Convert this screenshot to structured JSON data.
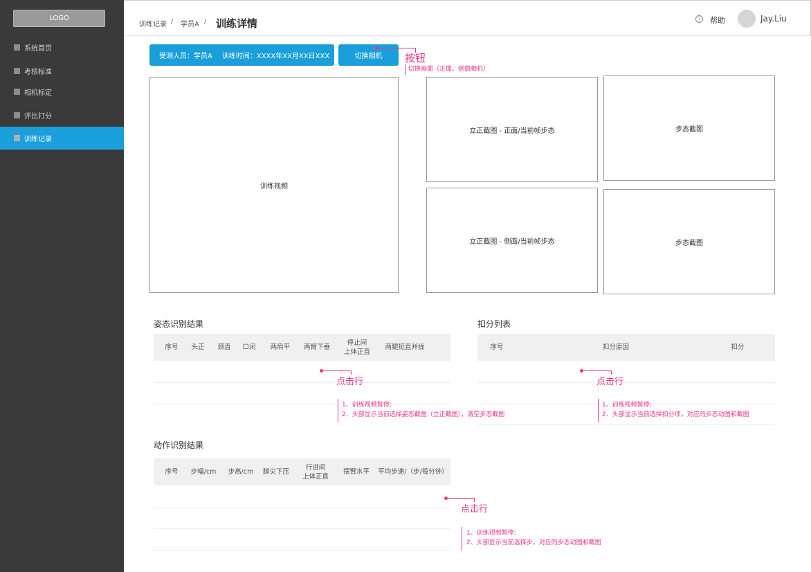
{
  "sidebar": {
    "logo": "LOGO",
    "items": [
      {
        "label": "系统首页"
      },
      {
        "label": "考核标准"
      },
      {
        "label": "相机标定"
      },
      {
        "label": "评比打分"
      },
      {
        "label": "训练记录"
      }
    ]
  },
  "header": {
    "breadcrumb": [
      "训练记录",
      "学员A"
    ],
    "separator": "/",
    "title": "训练详情",
    "help": "帮助",
    "help_icon_glyph": "?",
    "user": "Jay.Liu"
  },
  "info": {
    "person": "受测人员：学员A",
    "time": "训练时间：XXXX年XX月XX日XXX",
    "switch_button": "切换相机"
  },
  "panels": {
    "video": "训练视频",
    "front": "立正截图 - 正面/当前帧步态",
    "side": "立正截图 - 侧面/当前帧步态",
    "gait1": "步态截图",
    "gait2": "步态截图"
  },
  "posture": {
    "title": "姿态识别结果",
    "columns": [
      "序号",
      "头正",
      "颈直",
      "口闭",
      "两肩平",
      "两臂下垂",
      "停止间\n上体正直",
      "两腿挺直并拢"
    ]
  },
  "deduction": {
    "title": "扣分列表",
    "columns": [
      "序号",
      "扣分原因",
      "扣分"
    ]
  },
  "action": {
    "title": "动作识别结果",
    "columns": [
      "序号",
      "步幅/cm",
      "步高/cm",
      "脚尖下压",
      "行进间\n上体正直",
      "摆臂水平",
      "平均步速/（步/每分钟）"
    ]
  },
  "annotations": {
    "button_title": "按钮",
    "button_desc": "切换画面（正面、侧面相机）",
    "click_row": "点击行",
    "posture_notes": [
      "1、训练视频暂停;",
      "2、头部显示当前选择姿态截图（立正截图），清空步态截图"
    ],
    "deduction_notes": [
      "1、训练视频暂停;",
      "2、头部显示当前选择扣分项，对应的步态动图和截图"
    ],
    "action_notes": [
      "1、训练视频暂停;",
      "2、头部显示当前选择步，对应的步态动图和截图"
    ]
  },
  "colors": {
    "sidebar_bg": "#3a3a3a",
    "accent": "#1a9fdb",
    "annotation": "#e8358a"
  }
}
